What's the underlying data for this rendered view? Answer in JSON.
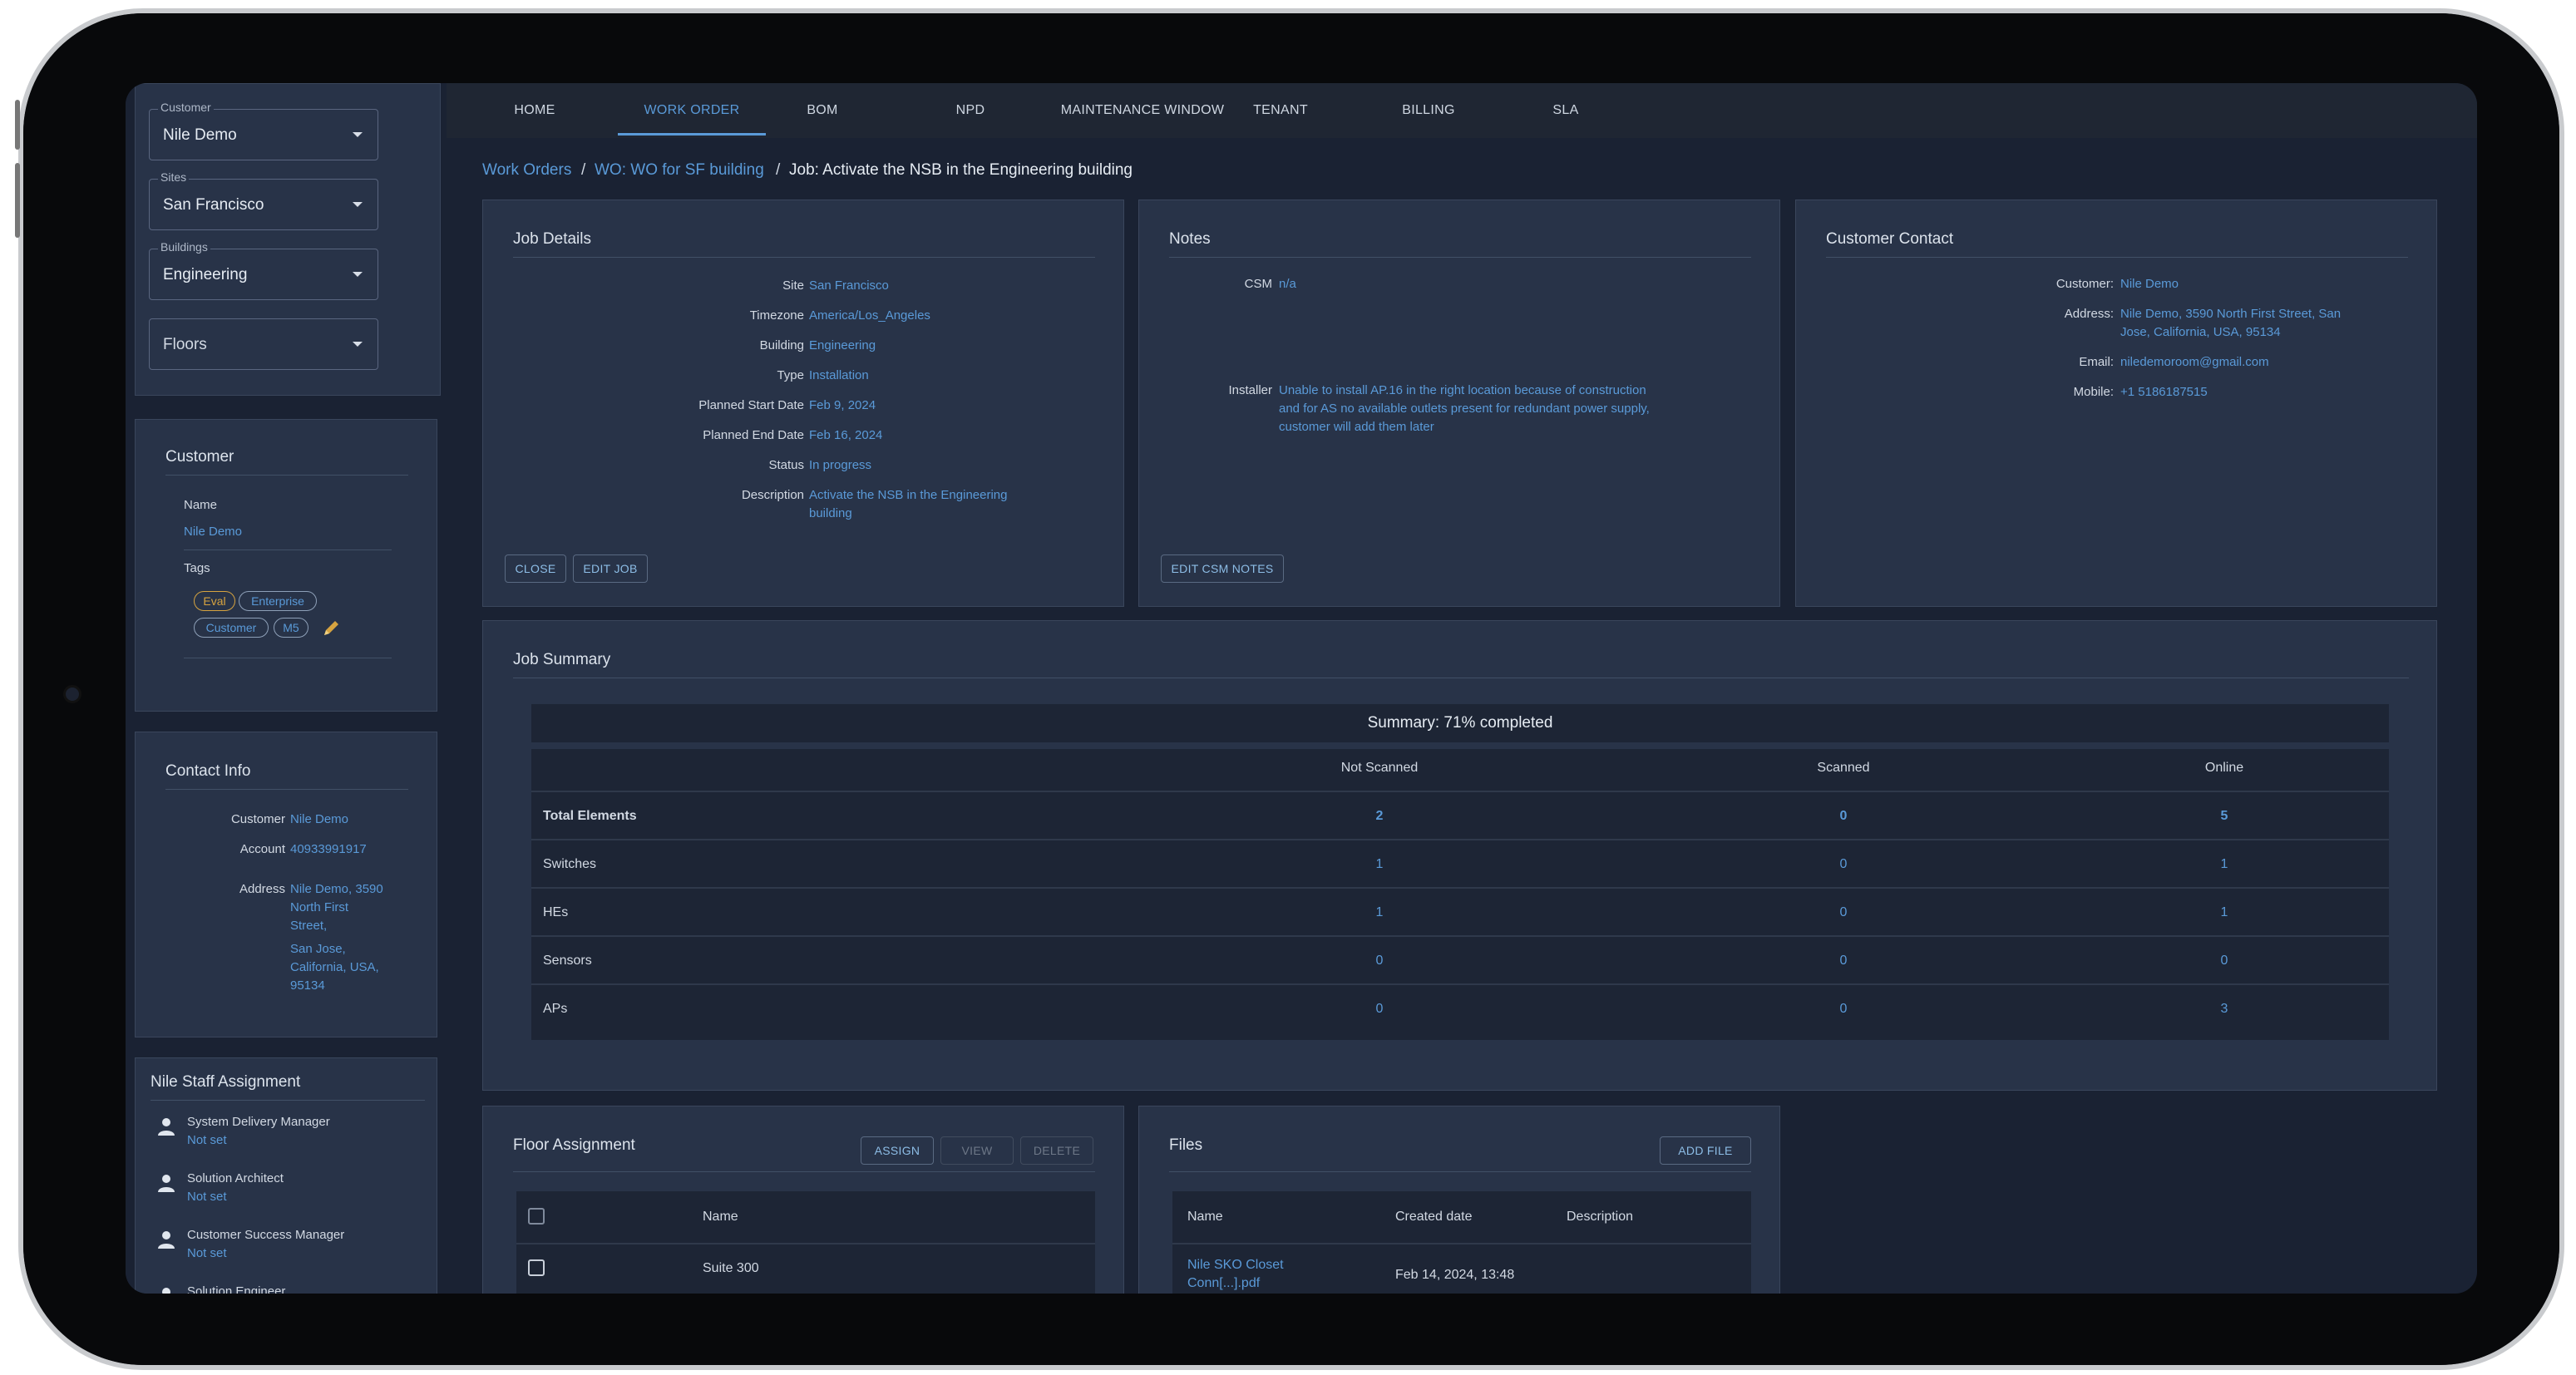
{
  "nav": {
    "items": [
      "HOME",
      "WORK ORDER",
      "BOM",
      "NPD",
      "MAINTENANCE WINDOW",
      "TENANT",
      "BILLING",
      "SLA"
    ],
    "active": "WORK ORDER"
  },
  "filters": {
    "customer_label": "Customer",
    "customer_value": "Nile Demo",
    "sites_label": "Sites",
    "sites_value": "San Francisco",
    "buildings_label": "Buildings",
    "buildings_value": "Engineering",
    "floors_placeholder": "Floors"
  },
  "customer_card": {
    "title": "Customer",
    "name_label": "Name",
    "name_value": "Nile Demo",
    "tags_label": "Tags",
    "tags": [
      "Eval",
      "Enterprise",
      "Customer",
      "M5"
    ]
  },
  "contact_info": {
    "title": "Contact Info",
    "customer_label": "Customer",
    "customer_value": "Nile Demo",
    "account_label": "Account",
    "account_value": "40933991917",
    "address_label": "Address",
    "address_line1": "Nile Demo, 3590",
    "address_line2": "North First",
    "address_line3": "Street,",
    "address_line4": "San Jose,",
    "address_line5": "California, USA,",
    "address_line6": "95134"
  },
  "staff": {
    "title": "Nile Staff Assignment",
    "roles": [
      {
        "role": "System Delivery Manager",
        "value": "Not set"
      },
      {
        "role": "Solution Architect",
        "value": "Not set"
      },
      {
        "role": "Customer Success Manager",
        "value": "Not set"
      },
      {
        "role": "Solution Engineer",
        "value": ""
      }
    ]
  },
  "breadcrumb": {
    "item1": "Work Orders",
    "item2": "WO: WO for SF building",
    "current": "Job: Activate the NSB in the Engineering building",
    "sep": "/"
  },
  "job_details": {
    "title": "Job Details",
    "fields": [
      {
        "label": "Site",
        "value": "San Francisco"
      },
      {
        "label": "Timezone",
        "value": "America/Los_Angeles"
      },
      {
        "label": "Building",
        "value": "Engineering"
      },
      {
        "label": "Type",
        "value": "Installation"
      },
      {
        "label": "Planned Start Date",
        "value": "Feb 9, 2024"
      },
      {
        "label": "Planned End Date",
        "value": "Feb 16, 2024"
      },
      {
        "label": "Status",
        "value": "In progress"
      }
    ],
    "description_label": "Description",
    "description_line1": "Activate the NSB in the Engineering",
    "description_line2": "building",
    "close_btn": "CLOSE",
    "edit_btn": "EDIT JOB"
  },
  "notes": {
    "title": "Notes",
    "csm_label": "CSM",
    "csm_value": "n/a",
    "installer_label": "Installer",
    "installer_line1": "Unable to install AP.16 in the right location because of construction",
    "installer_line2": "and for AS no available outlets present for redundant power supply,",
    "installer_line3": "customer will add them later",
    "edit_btn": "EDIT CSM NOTES"
  },
  "customer_contact": {
    "title": "Customer Contact",
    "customer_label": "Customer:",
    "customer_value": "Nile Demo",
    "address_label": "Address:",
    "address_line1": "Nile Demo, 3590 North First Street, San",
    "address_line2": "Jose, California, USA, 95134",
    "email_label": "Email:",
    "email_value": "niledemoroom@gmail.com",
    "mobile_label": "Mobile:",
    "mobile_value": "+1 5186187515"
  },
  "job_summary": {
    "title": "Job Summary",
    "summary_text": "Summary: 71% completed",
    "headers": [
      "Not Scanned",
      "Scanned",
      "Online"
    ],
    "rows": [
      {
        "name": "Total Elements",
        "values": [
          "2",
          "0",
          "5"
        ]
      },
      {
        "name": "Switches",
        "values": [
          "1",
          "0",
          "1"
        ]
      },
      {
        "name": "HEs",
        "values": [
          "1",
          "0",
          "1"
        ]
      },
      {
        "name": "Sensors",
        "values": [
          "0",
          "0",
          "0"
        ]
      },
      {
        "name": "APs",
        "values": [
          "0",
          "0",
          "3"
        ]
      }
    ]
  },
  "floor_assignment": {
    "title": "Floor Assignment",
    "assign_btn": "ASSIGN",
    "view_btn": "VIEW",
    "delete_btn": "DELETE",
    "name_header": "Name",
    "rows": [
      "Suite 300"
    ]
  },
  "files": {
    "title": "Files",
    "add_btn": "ADD FILE",
    "headers": [
      "Name",
      "Created date",
      "Description"
    ],
    "rows": [
      {
        "name_line1": "Nile SKO Closet",
        "name_line2": "Conn[...].pdf",
        "created": "Feb 14, 2024, 13:48",
        "description": ""
      }
    ]
  }
}
